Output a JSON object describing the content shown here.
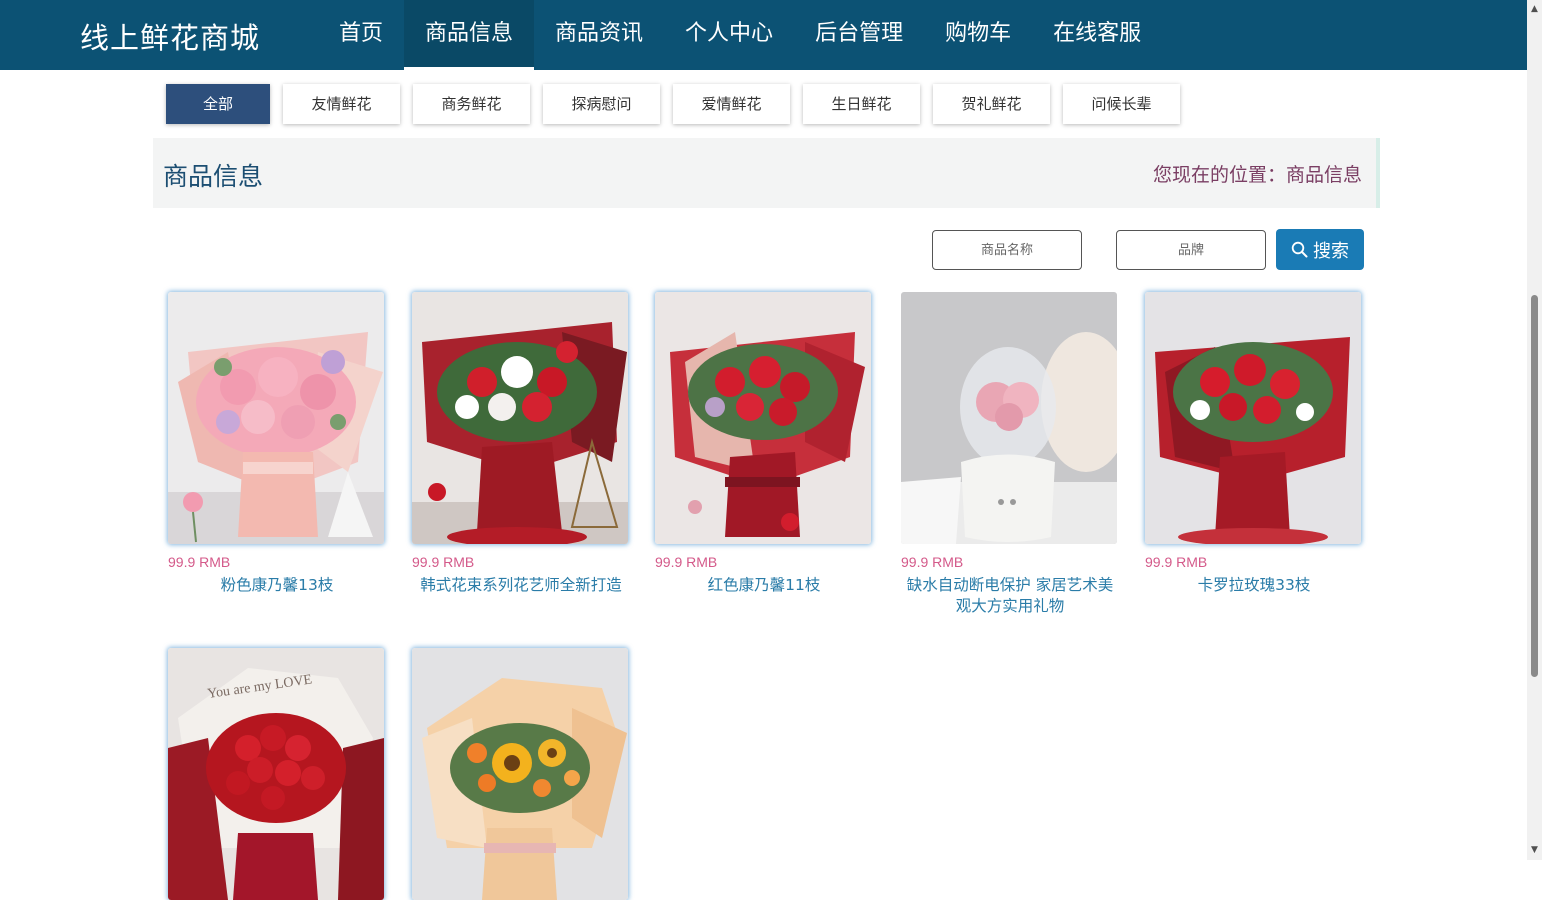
{
  "header": {
    "logo": "线上鲜花商城",
    "nav": [
      {
        "label": "首页",
        "active": false
      },
      {
        "label": "商品信息",
        "active": true
      },
      {
        "label": "商品资讯",
        "active": false
      },
      {
        "label": "个人中心",
        "active": false
      },
      {
        "label": "后台管理",
        "active": false
      },
      {
        "label": "购物车",
        "active": false
      },
      {
        "label": "在线客服",
        "active": false
      }
    ]
  },
  "categories": [
    "全部",
    "友情鲜花",
    "商务鲜花",
    "探病慰问",
    "爱情鲜花",
    "生日鲜花",
    "贺礼鲜花",
    "问候长辈"
  ],
  "section": {
    "title": "商品信息",
    "breadcrumb": "您现在的位置：商品信息"
  },
  "search": {
    "name_placeholder": "商品名称",
    "brand_placeholder": "品牌",
    "button_label": "搜索"
  },
  "products": [
    {
      "price": "99.9 RMB",
      "name": "粉色康乃馨13枝",
      "image": "pink-carnation-bouquet"
    },
    {
      "price": "99.9 RMB",
      "name": "韩式花束系列花艺师全新打造",
      "image": "red-white-rose-bouquet"
    },
    {
      "price": "99.9 RMB",
      "name": "红色康乃馨11枝",
      "image": "red-carnation-bouquet"
    },
    {
      "price": "99.9 RMB",
      "name": "缺水自动断电保护 家居艺术美观大方实用礼物",
      "image": "preserved-rose-humidifier"
    },
    {
      "price": "99.9 RMB",
      "name": "卡罗拉玫瑰33枝",
      "image": "red-rose-bouquet"
    },
    {
      "price": "",
      "name": "",
      "image": "red-rose-love-bouquet",
      "image_text": "You are my LOVE"
    },
    {
      "price": "",
      "name": "",
      "image": "sunflower-bouquet"
    }
  ],
  "colors": {
    "header_bg": "#0c5274",
    "active_category": "#2d4f7c",
    "search_button": "#1a7bb5",
    "price": "#d45a8a",
    "product_name": "#2a7ca8"
  }
}
